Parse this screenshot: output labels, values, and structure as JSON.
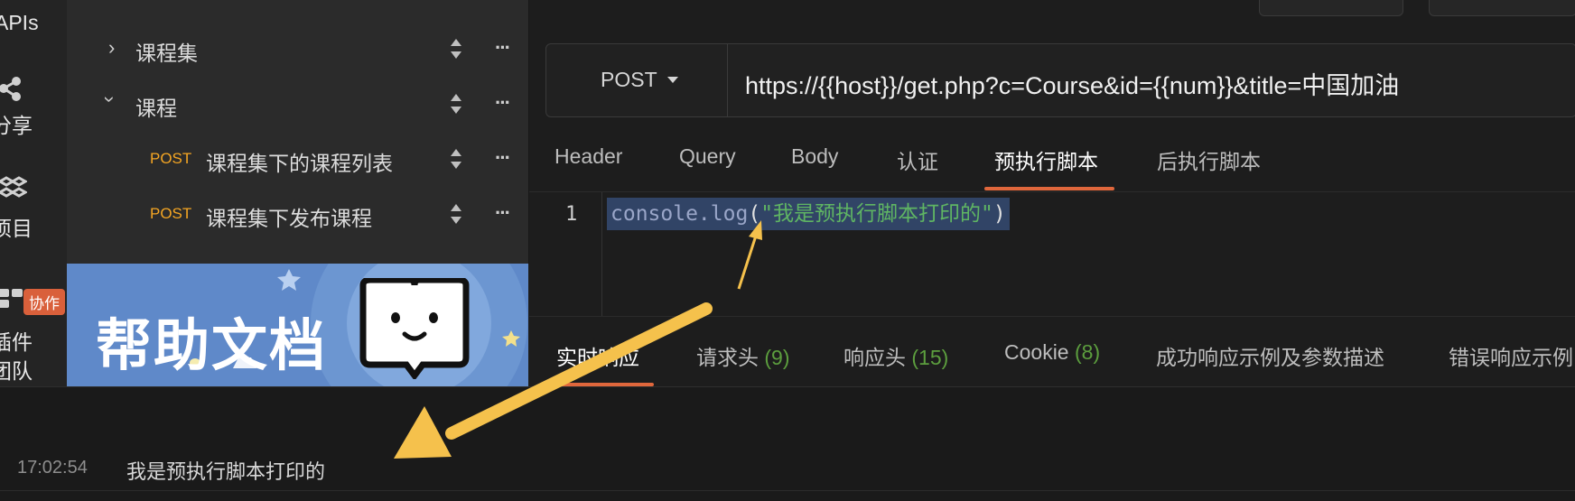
{
  "rail": {
    "items": [
      {
        "label": "APIs",
        "icon": "apis-icon"
      },
      {
        "label": "分享",
        "icon": "share-icon"
      },
      {
        "label": "项目",
        "icon": "cubes-icon"
      },
      {
        "label": "插件",
        "icon": "grid-icon",
        "badge": "协作"
      },
      {
        "label": "团队",
        "icon": "team-icon"
      }
    ]
  },
  "tree": {
    "items": [
      {
        "label": "课程集",
        "expanded": false
      },
      {
        "label": "课程",
        "expanded": true
      },
      {
        "method": "POST",
        "label": "课程集下的课程列表"
      },
      {
        "method": "POST",
        "label": "课程集下发布课程"
      }
    ]
  },
  "banner": {
    "title": "帮助文档",
    "bg_color": "#5f89c9"
  },
  "request": {
    "method": "POST",
    "url": "https://{{host}}/get.php?c=Course&id={{num}}&title=中国加油",
    "tabs": [
      "Header",
      "Query",
      "Body",
      "认证",
      "预执行脚本",
      "后执行脚本"
    ],
    "active_tab": "预执行脚本",
    "accent_color": "#e0673c"
  },
  "editor": {
    "line_number": "1",
    "code_fn": "console.log",
    "code_open": "(",
    "code_string": "\"我是预执行脚本打印的\"",
    "code_close": ")"
  },
  "response": {
    "tabs": [
      {
        "label": "实时响应",
        "count": ""
      },
      {
        "label": "请求头",
        "count": "(9)"
      },
      {
        "label": "响应头",
        "count": "(15)"
      },
      {
        "label": "Cookie",
        "count": "(8)"
      },
      {
        "label": "成功响应示例及参数描述",
        "count": ""
      },
      {
        "label": "错误响应示例",
        "count": ""
      }
    ],
    "active_tab": "实时响应",
    "count_color": "#5c9e3e"
  },
  "console": {
    "time": "17:02:54",
    "message": "我是预执行脚本打印的"
  },
  "annotations": {
    "arrow_color": "#f5c14c"
  }
}
